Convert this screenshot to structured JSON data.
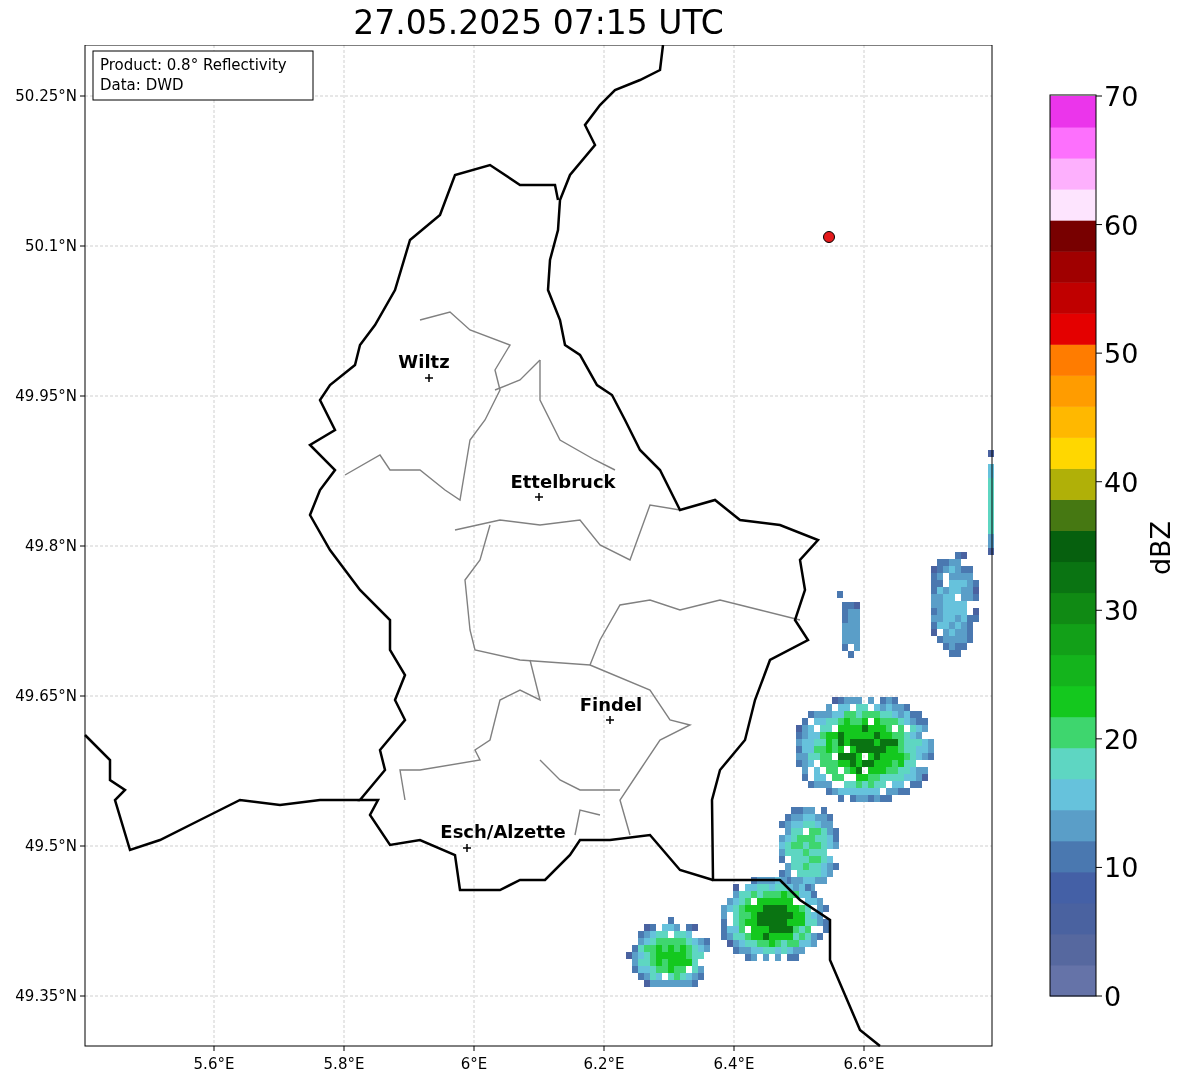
{
  "title": "27.05.2025 07:15 UTC",
  "map": {
    "info_box": [
      "Product: 0.8° Reflectivity",
      "Data: DWD"
    ],
    "lat_ticks": [
      "50.25°N",
      "50.1°N",
      "49.95°N",
      "49.8°N",
      "49.65°N",
      "49.5°N",
      "49.35°N"
    ],
    "lon_ticks": [
      "5.6°E",
      "5.8°E",
      "6°E",
      "6.2°E",
      "6.4°E",
      "6.6°E"
    ],
    "places": [
      {
        "name": "Wiltz"
      },
      {
        "name": "Ettelbruck"
      },
      {
        "name": "Findel"
      },
      {
        "name": "Esch/Alzette"
      }
    ],
    "marker": {
      "color": "#e41a1c"
    }
  },
  "colorbar": {
    "label": "dBZ",
    "ticks": [
      "70",
      "60",
      "50",
      "40",
      "30",
      "20",
      "10",
      "0"
    ],
    "bins": [
      {
        "color": "#6573a8"
      },
      {
        "color": "#56689f"
      },
      {
        "color": "#4a62a0"
      },
      {
        "color": "#4460a6"
      },
      {
        "color": "#4a78b0"
      },
      {
        "color": "#5a9ec8"
      },
      {
        "color": "#66c2dc"
      },
      {
        "color": "#5ed6c2"
      },
      {
        "color": "#3ed66e"
      },
      {
        "color": "#14c81e"
      },
      {
        "color": "#14b41c"
      },
      {
        "color": "#12a018"
      },
      {
        "color": "#108a14"
      },
      {
        "color": "#0a7412"
      },
      {
        "color": "#06600e"
      },
      {
        "color": "#467812"
      },
      {
        "color": "#b0b008"
      },
      {
        "color": "#ffd700"
      },
      {
        "color": "#ffb800"
      },
      {
        "color": "#ff9c00"
      },
      {
        "color": "#ff7c00"
      },
      {
        "color": "#e40000"
      },
      {
        "color": "#c00000"
      },
      {
        "color": "#a00000"
      },
      {
        "color": "#780000"
      },
      {
        "color": "#fde4fe"
      },
      {
        "color": "#fdb0fd"
      },
      {
        "color": "#fd70fd"
      },
      {
        "color": "#eb35eb"
      }
    ]
  }
}
